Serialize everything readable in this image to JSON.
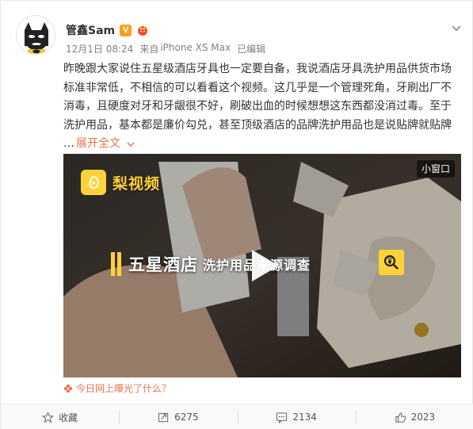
{
  "post": {
    "author": "管鑫Sam",
    "verified_badge": "V",
    "date": "12月1日 08:24",
    "source_prefix": "来自",
    "source": "iPhone XS Max",
    "edited": "已编辑",
    "text_lines": [
      "昨晚跟大家说住五星级酒店牙具也一定要自备，我说酒店牙具洗护用品供货市场",
      "标准非常低，不相信的可以看看这个视频。这几乎是一个管理死角，牙刷出厂不",
      "消毒，且硬度对牙和牙龈很不好，刷破出血的时候想想这东西都没消过毒。至于",
      "洗护用品，基本都是廉价勾兑，甚至顶级酒店的品牌洗护用品也是说贴牌就贴牌"
    ],
    "ellipsis": "…",
    "expand_label": "展开全文"
  },
  "video": {
    "mini_window_label": "小窗口",
    "logo_text": "梨视频",
    "banner_big": "五星酒店",
    "banner_small": "洗护用品来源调查"
  },
  "topic": {
    "label": "今日网上曝光了什么？"
  },
  "actions": {
    "favorite_label": "收藏",
    "repost_count": "6275",
    "comment_count": "2134",
    "like_count": "2023"
  },
  "colors": {
    "accent": "#eb7350",
    "badge": "#f9a31b",
    "pear_yellow": "#ffd23a"
  }
}
